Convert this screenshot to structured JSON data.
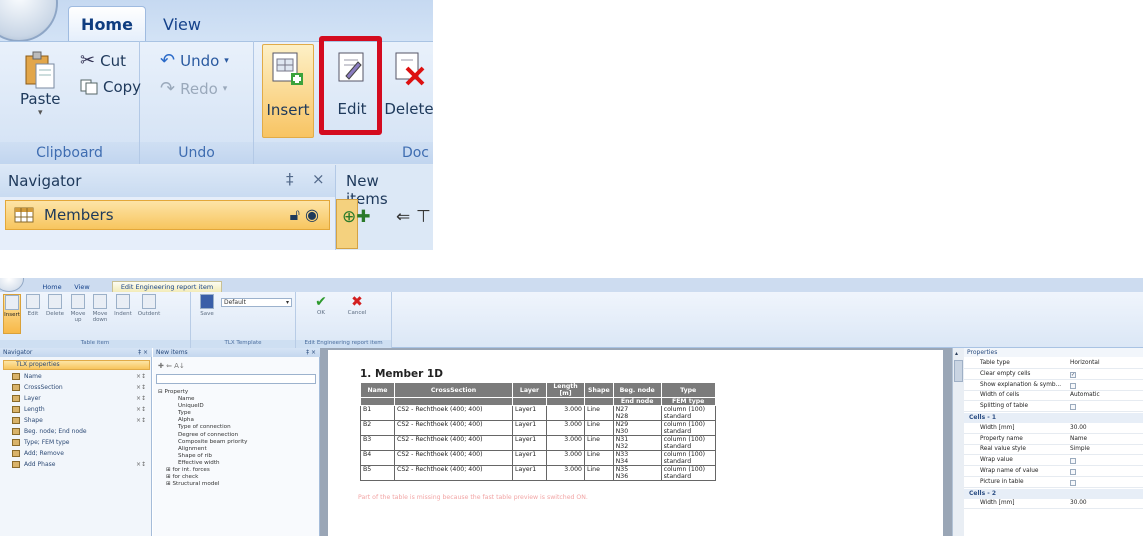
{
  "top": {
    "tabs": [
      "Home",
      "View"
    ],
    "clipboard": {
      "paste": "Paste",
      "cut": "Cut",
      "copy": "Copy",
      "group": "Clipboard"
    },
    "undo": {
      "undo": "Undo",
      "redo": "Redo",
      "group": "Undo"
    },
    "document": {
      "insert": "Insert",
      "edit": "Edit",
      "delete": "Delete",
      "group": "Doc"
    },
    "navigator": {
      "title": "Navigator",
      "pin": "‡",
      "close": "×",
      "item": "Members"
    },
    "new_items": {
      "title": "New items"
    }
  },
  "bottom": {
    "tabs": [
      "Home",
      "View",
      "Edit Engineering report item"
    ],
    "ribbon": {
      "buttons": [
        "Insert",
        "Edit",
        "Delete",
        "Move up",
        "Move down",
        "Indent",
        "Outdent",
        "Save",
        "OK",
        "Cancel"
      ],
      "template_value": "Default",
      "groups": [
        "Table item",
        "TLX Template",
        "Edit Engineering report item"
      ]
    },
    "navigator": {
      "title": "Navigator",
      "root": "TLX properties",
      "items": [
        "Name",
        "CrossSection",
        "Layer",
        "Length",
        "Shape",
        "Beg. node; End node",
        "Type; FEM type",
        "Add; Remove",
        "Add Phase"
      ]
    },
    "new_items": {
      "title": "New items",
      "tree_root": "Property",
      "tree_items": [
        "Name",
        "UniqueID",
        "Type",
        "Alpha",
        "Type of connection",
        "Degree of connection",
        "Composite beam priority",
        "Alignment",
        "Shape of rib",
        "Effective width"
      ],
      "tree_groups": [
        "for int. forces",
        "for check",
        "Structural model"
      ]
    },
    "report": {
      "title": "1. Member 1D",
      "headers": [
        "Name",
        "CrossSection",
        "Layer",
        "Length [m]",
        "Shape",
        "Beg. node",
        "Type"
      ],
      "subheaders": [
        "End node",
        "FEM type"
      ],
      "rows": [
        {
          "name": "B1",
          "cs": "CS2 - Rechthoek (400; 400)",
          "layer": "Layer1",
          "length": "3.000",
          "shape": "Line",
          "n1": "N27",
          "n2": "N28",
          "type": "column (100)",
          "fem": "standard"
        },
        {
          "name": "B2",
          "cs": "CS2 - Rechthoek (400; 400)",
          "layer": "Layer1",
          "length": "3.000",
          "shape": "Line",
          "n1": "N29",
          "n2": "N30",
          "type": "column (100)",
          "fem": "standard"
        },
        {
          "name": "B3",
          "cs": "CS2 - Rechthoek (400; 400)",
          "layer": "Layer1",
          "length": "3.000",
          "shape": "Line",
          "n1": "N31",
          "n2": "N32",
          "type": "column (100)",
          "fem": "standard"
        },
        {
          "name": "B4",
          "cs": "CS2 - Rechthoek (400; 400)",
          "layer": "Layer1",
          "length": "3.000",
          "shape": "Line",
          "n1": "N33",
          "n2": "N34",
          "type": "column (100)",
          "fem": "standard"
        },
        {
          "name": "B5",
          "cs": "CS2 - Rechthoek (400; 400)",
          "layer": "Layer1",
          "length": "3.000",
          "shape": "Line",
          "n1": "N35",
          "n2": "N36",
          "type": "column (100)",
          "fem": "standard"
        }
      ],
      "warning": "Part of the table is missing because the fast table preview is switched ON."
    },
    "properties": {
      "title": "Properties",
      "rows": [
        {
          "k": "Table type",
          "v": "Horizontal"
        },
        {
          "k": "Clear empty cells",
          "v": "checked"
        },
        {
          "k": "Show explanation & symb...",
          "v": ""
        },
        {
          "k": "Width of cells",
          "v": "Automatic"
        },
        {
          "k": "Splitting of table",
          "v": ""
        }
      ],
      "cells1_title": "Cells - 1",
      "cells1": [
        {
          "k": "Width [mm]",
          "v": "30.00"
        },
        {
          "k": "Property name",
          "v": "Name"
        },
        {
          "k": "Real value style",
          "v": "Simple"
        },
        {
          "k": "Wrap value",
          "v": ""
        },
        {
          "k": "Wrap name of value",
          "v": ""
        },
        {
          "k": "Picture in table",
          "v": ""
        }
      ],
      "cells2_title": "Cells - 2",
      "cells2": [
        {
          "k": "Width [mm]",
          "v": "30.00"
        }
      ]
    }
  }
}
